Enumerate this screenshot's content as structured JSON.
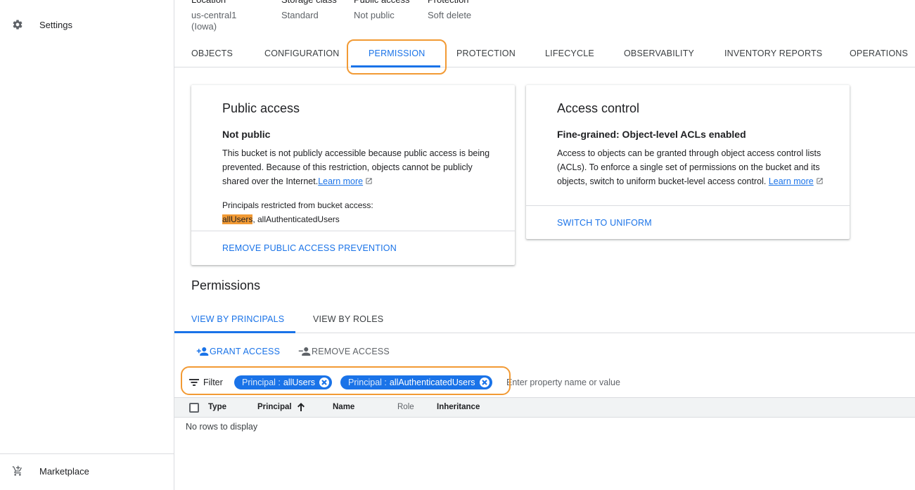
{
  "sidebar": {
    "items": [
      {
        "label": "Settings",
        "icon": "gear-icon"
      },
      {
        "label": "Marketplace",
        "icon": "cart-icon"
      }
    ]
  },
  "bucket_props": [
    {
      "label": "Location",
      "value": "us-central1 (Iowa)"
    },
    {
      "label": "Storage class",
      "value": "Standard"
    },
    {
      "label": "Public access",
      "value": "Not public"
    },
    {
      "label": "Protection",
      "value": "Soft delete"
    }
  ],
  "tabs": [
    "OBJECTS",
    "CONFIGURATION",
    "PERMISSION",
    "PROTECTION",
    "LIFECYCLE",
    "OBSERVABILITY",
    "INVENTORY REPORTS",
    "OPERATIONS"
  ],
  "active_tab": "PERMISSION",
  "public_access": {
    "title": "Public access",
    "status": "Not public",
    "desc_line1": "This bucket is not publicly accessible because public access is being",
    "desc_line2": "prevented. Because of this restriction, objects cannot be publicly",
    "desc_line3": "shared over the Internet.",
    "learn_more": "Learn more",
    "principals_label": "Principals restricted from bucket access:",
    "principal_highlighted": "allUsers",
    "principal_rest": ", allAuthenticatedUsers",
    "action": "REMOVE PUBLIC ACCESS PREVENTION"
  },
  "access_control": {
    "title": "Access control",
    "status": "Fine-grained: Object-level ACLs enabled",
    "desc_line1": "Access to objects can be granted through object access control lists",
    "desc_line2": "(ACLs). To enforce a single set of permissions on the bucket and its",
    "desc_line3": "objects, switch to uniform bucket-level access control. ",
    "learn_more": "Learn more",
    "action": "SWITCH TO UNIFORM"
  },
  "permissions": {
    "title": "Permissions",
    "subtabs": [
      "VIEW BY PRINCIPALS",
      "VIEW BY ROLES"
    ],
    "grant_access": "GRANT ACCESS",
    "remove_access": "REMOVE ACCESS",
    "filter_label": "Filter",
    "chips": [
      {
        "key": "Principal :",
        "value": "allUsers"
      },
      {
        "key": "Principal :",
        "value": "allAuthenticatedUsers"
      }
    ],
    "filter_placeholder": "Enter property name or value",
    "columns": [
      "Type",
      "Principal",
      "Name",
      "Role",
      "Inheritance"
    ],
    "empty_text": "No rows to display"
  },
  "colors": {
    "accent": "#1a73e8",
    "callout": "#f29a34",
    "divider": "#dadce0"
  }
}
